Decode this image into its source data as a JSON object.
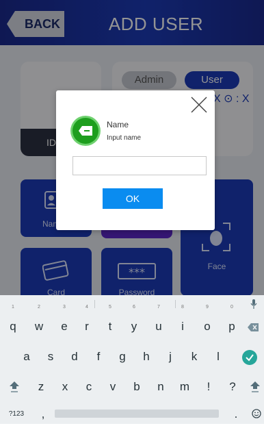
{
  "header": {
    "back_label": "BACK",
    "title": "ADD USER"
  },
  "background": {
    "id_card_label": "ID",
    "role_toggle": {
      "admin": "Admin",
      "user": "User"
    },
    "xcode": "X ⊙ : X",
    "tiles": {
      "name": "Name",
      "face": "Face",
      "card": "Card",
      "password": "Password"
    }
  },
  "modal": {
    "field_label": "Name",
    "hint": "Input name",
    "input_value": "",
    "ok_label": "OK"
  },
  "keyboard": {
    "row1": [
      "q",
      "w",
      "e",
      "r",
      "t",
      "y",
      "u",
      "i",
      "o",
      "p"
    ],
    "row1_hints": [
      "1",
      "2",
      "3",
      "4",
      "5",
      "6",
      "7",
      "8",
      "9",
      "0"
    ],
    "row2": [
      "a",
      "s",
      "d",
      "f",
      "g",
      "h",
      "j",
      "k",
      "l"
    ],
    "row3": [
      "z",
      "x",
      "c",
      "v",
      "b",
      "n",
      "m",
      "!",
      "?"
    ],
    "row4": {
      "symbols": "?123",
      "comma": ",",
      "period": "."
    }
  }
}
